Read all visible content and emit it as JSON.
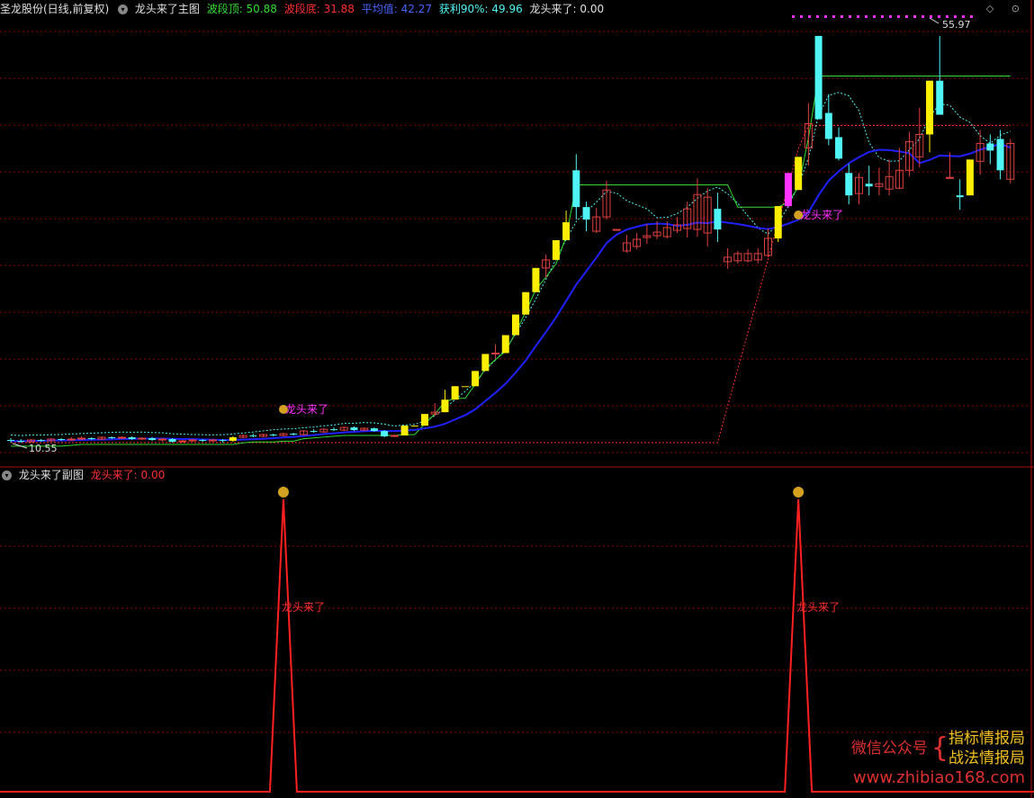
{
  "main_header": {
    "stock": "圣龙股份(日线,前复权)",
    "indicator": "龙头来了主图",
    "wave_top_label": "波段顶: 50.88",
    "wave_bottom_label": "波段底: 31.88",
    "avg_label": "平均值: 42.27",
    "profit_label": "获利90%: 49.96",
    "signal_label": "龙头来了: 0.00"
  },
  "sub_header": {
    "indicator": "龙头来了副图",
    "signal_label": "龙头来了: 0.00"
  },
  "top_right_icons": "◇ ⊙",
  "annotations": {
    "high_price": "55.97",
    "low_price": "10.55",
    "signal_text": "龙头来了",
    "signal_icon": "$"
  },
  "watermark": {
    "line1_left": "微信公众号",
    "line1_right": "指标情报局",
    "line2_right": "战法情报局",
    "url": "www.zhibiao168.com"
  },
  "colors": {
    "bg": "#000000",
    "up": "#e04040",
    "down": "#4ff5f5",
    "limit_up": "#ffee00",
    "signal": "#ff33ff",
    "ma": "#2020ff",
    "wave_top": "#33dd33",
    "grid": "#8b0000",
    "wave_top_text": "#33dd33",
    "wave_bottom_text": "#ff3030",
    "avg_text": "#4466ff",
    "profit_text": "#4ff5f5"
  },
  "chart_data": [
    {
      "type": "candlestick",
      "title": "龙头来了主图",
      "y_range": [
        10,
        58
      ],
      "candles": [
        [
          10.9,
          10.8,
          11.1,
          10.6,
          "down"
        ],
        [
          10.8,
          10.7,
          11.0,
          10.6,
          "down"
        ],
        [
          10.7,
          10.9,
          11.0,
          10.6,
          "up"
        ],
        [
          10.9,
          10.8,
          11.0,
          10.7,
          "down"
        ],
        [
          10.8,
          11.0,
          11.1,
          10.7,
          "up"
        ],
        [
          11.0,
          10.9,
          11.1,
          10.8,
          "down"
        ],
        [
          10.9,
          11.0,
          11.2,
          10.8,
          "up"
        ],
        [
          11.0,
          11.1,
          11.3,
          10.9,
          "up"
        ],
        [
          11.1,
          11.0,
          11.2,
          10.9,
          "down"
        ],
        [
          11.0,
          11.2,
          11.3,
          10.9,
          "up"
        ],
        [
          11.2,
          11.1,
          11.3,
          11.0,
          "down"
        ],
        [
          11.1,
          11.2,
          11.3,
          11.0,
          "up"
        ],
        [
          11.2,
          11.0,
          11.3,
          10.9,
          "down"
        ],
        [
          11.0,
          11.1,
          11.2,
          10.9,
          "up"
        ],
        [
          11.1,
          10.9,
          11.2,
          10.8,
          "down"
        ],
        [
          10.9,
          11.0,
          11.1,
          10.7,
          "up"
        ],
        [
          11.0,
          10.7,
          11.1,
          10.6,
          "down"
        ],
        [
          10.7,
          10.8,
          10.9,
          10.6,
          "up"
        ],
        [
          10.8,
          10.9,
          11.0,
          10.7,
          "up"
        ],
        [
          10.9,
          10.8,
          11.0,
          10.7,
          "down"
        ],
        [
          10.8,
          10.9,
          11.0,
          10.7,
          "up"
        ],
        [
          10.9,
          10.8,
          11.0,
          10.6,
          "down"
        ],
        [
          10.8,
          11.2,
          11.3,
          10.7,
          "limit"
        ],
        [
          11.2,
          11.4,
          11.5,
          11.1,
          "up"
        ],
        [
          11.4,
          11.3,
          11.6,
          11.2,
          "down"
        ],
        [
          11.3,
          11.5,
          11.6,
          11.2,
          "up"
        ],
        [
          11.5,
          11.4,
          11.6,
          11.3,
          "down"
        ],
        [
          11.4,
          11.6,
          11.7,
          11.3,
          "up"
        ],
        [
          11.6,
          11.5,
          11.7,
          11.4,
          "down"
        ],
        [
          11.5,
          11.9,
          12.0,
          11.4,
          "up"
        ],
        [
          11.9,
          11.8,
          12.1,
          11.7,
          "down"
        ],
        [
          11.8,
          12.1,
          12.2,
          11.7,
          "up"
        ],
        [
          12.1,
          12.0,
          12.3,
          11.9,
          "down"
        ],
        [
          12.0,
          12.3,
          12.4,
          11.9,
          "up"
        ],
        [
          12.3,
          12.0,
          12.4,
          11.9,
          "down"
        ],
        [
          12.0,
          12.2,
          12.3,
          11.9,
          "up"
        ],
        [
          12.2,
          11.9,
          12.3,
          11.8,
          "down"
        ],
        [
          11.9,
          11.3,
          12.0,
          11.2,
          "down"
        ],
        [
          11.3,
          11.4,
          11.5,
          11.2,
          "up"
        ],
        [
          11.4,
          12.5,
          12.5,
          11.4,
          "limit"
        ],
        [
          12.5,
          12.5,
          12.5,
          12.5,
          "limit"
        ],
        [
          12.5,
          13.8,
          13.8,
          12.5,
          "limit"
        ],
        [
          13.8,
          14.0,
          15.0,
          13.6,
          "up"
        ],
        [
          14.0,
          15.4,
          16.5,
          14.0,
          "limit"
        ],
        [
          15.4,
          16.9,
          16.9,
          15.4,
          "limit"
        ],
        [
          16.9,
          16.9,
          16.9,
          16.9,
          "limit"
        ],
        [
          16.9,
          18.6,
          18.6,
          16.9,
          "limit"
        ],
        [
          18.6,
          20.5,
          20.5,
          18.6,
          "limit"
        ],
        [
          20.5,
          20.6,
          21.6,
          20.0,
          "up"
        ],
        [
          20.6,
          22.6,
          22.6,
          20.6,
          "limit"
        ],
        [
          22.6,
          24.9,
          24.9,
          22.6,
          "limit"
        ],
        [
          24.9,
          27.4,
          27.4,
          24.9,
          "limit"
        ],
        [
          27.4,
          30.1,
          30.1,
          27.4,
          "limit"
        ],
        [
          30.1,
          31.0,
          31.6,
          29.0,
          "up"
        ],
        [
          31.0,
          33.2,
          33.2,
          31.0,
          "limit"
        ],
        [
          33.2,
          35.2,
          36.5,
          33.2,
          "limit"
        ],
        [
          41.0,
          36.9,
          42.8,
          35.5,
          "down"
        ],
        [
          36.9,
          35.5,
          37.5,
          34.2,
          "down"
        ],
        [
          34.2,
          35.8,
          36.8,
          34.0,
          "up"
        ],
        [
          35.8,
          38.8,
          39.8,
          35.5,
          "up"
        ],
        [
          34.4,
          34.4,
          34.4,
          34.4,
          "up"
        ],
        [
          32.0,
          32.9,
          33.8,
          31.8,
          "up"
        ],
        [
          32.5,
          33.3,
          34.0,
          32.2,
          "up"
        ],
        [
          33.5,
          33.7,
          35.0,
          32.8,
          "up"
        ],
        [
          33.7,
          34.1,
          35.3,
          33.3,
          "up"
        ],
        [
          33.6,
          34.6,
          35.3,
          33.4,
          "up"
        ],
        [
          34.3,
          34.9,
          35.8,
          34.0,
          "up"
        ],
        [
          34.5,
          36.7,
          37.5,
          33.5,
          "up"
        ],
        [
          34.4,
          38.3,
          40.1,
          33.6,
          "up"
        ],
        [
          34.0,
          38.0,
          39.0,
          32.5,
          "up"
        ],
        [
          34.4,
          36.7,
          38.5,
          33.0,
          "down"
        ],
        [
          30.8,
          31.3,
          32.3,
          30.0,
          "up"
        ],
        [
          30.9,
          31.7,
          32.0,
          30.6,
          "up"
        ],
        [
          30.9,
          31.7,
          32.2,
          30.7,
          "up"
        ],
        [
          31.0,
          31.7,
          32.3,
          30.6,
          "up"
        ],
        [
          31.5,
          33.4,
          34.5,
          31.3,
          "up"
        ],
        [
          33.4,
          37.0,
          37.0,
          33.0,
          "limit"
        ],
        [
          37.0,
          40.7,
          40.7,
          36.8,
          "signal"
        ],
        [
          38.8,
          42.5,
          42.5,
          38.8,
          "limit"
        ],
        [
          43.5,
          46.2,
          48.5,
          41.5,
          "up"
        ],
        [
          46.7,
          56.0,
          56.0,
          46.7,
          "down"
        ],
        [
          44.5,
          47.4,
          49.5,
          43.8,
          "down"
        ],
        [
          44.7,
          42.3,
          45.8,
          42.1,
          "down"
        ],
        [
          38.2,
          40.7,
          41.7,
          37.2,
          "down"
        ],
        [
          40.2,
          38.4,
          40.7,
          37.2,
          "up"
        ],
        [
          39.5,
          39.2,
          41.5,
          38.2,
          "down"
        ],
        [
          39.2,
          39.5,
          41.3,
          38.2,
          "up"
        ],
        [
          38.9,
          40.3,
          42.2,
          38.2,
          "up"
        ],
        [
          39.0,
          41.0,
          43.5,
          38.9,
          "up"
        ],
        [
          41.0,
          44.2,
          45.3,
          40.3,
          "up"
        ],
        [
          42.5,
          45.0,
          48.0,
          41.3,
          "up"
        ],
        [
          45.0,
          51.0,
          51.0,
          43.0,
          "limit"
        ],
        [
          51.0,
          47.2,
          56.0,
          47.2,
          "down"
        ],
        [
          40.2,
          40.2,
          43.0,
          40.2,
          "up"
        ],
        [
          38.2,
          38.0,
          40.0,
          36.6,
          "down"
        ],
        [
          38.2,
          42.2,
          42.2,
          38.2,
          "limit"
        ],
        [
          42.0,
          44.0,
          45.5,
          40.5,
          "up"
        ],
        [
          44.0,
          43.2,
          45.0,
          41.7,
          "down"
        ],
        [
          41.0,
          44.5,
          45.5,
          40.0,
          "down"
        ],
        [
          44.0,
          40.0,
          44.5,
          39.5,
          "up"
        ]
      ],
      "signals": [
        27,
        78
      ]
    },
    {
      "type": "line",
      "title": "龙头来了副图",
      "signals": [
        27,
        78
      ],
      "y_range": [
        0,
        1
      ]
    }
  ]
}
